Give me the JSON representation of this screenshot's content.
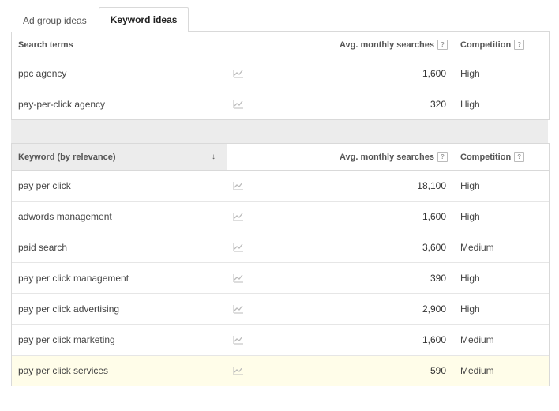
{
  "tabs": {
    "ad_group": "Ad group ideas",
    "keyword": "Keyword ideas"
  },
  "columns": {
    "search_terms": "Search terms",
    "avg_searches": "Avg. monthly searches",
    "competition": "Competition",
    "keyword_relevance": "Keyword (by relevance)"
  },
  "search_terms_rows": [
    {
      "term": "ppc agency",
      "avg": "1,600",
      "competition": "High"
    },
    {
      "term": "pay-per-click agency",
      "avg": "320",
      "competition": "High"
    }
  ],
  "keyword_rows": [
    {
      "term": "pay per click",
      "avg": "18,100",
      "competition": "High"
    },
    {
      "term": "adwords management",
      "avg": "1,600",
      "competition": "High"
    },
    {
      "term": "paid search",
      "avg": "3,600",
      "competition": "Medium"
    },
    {
      "term": "pay per click management",
      "avg": "390",
      "competition": "High"
    },
    {
      "term": "pay per click advertising",
      "avg": "2,900",
      "competition": "High"
    },
    {
      "term": "pay per click marketing",
      "avg": "1,600",
      "competition": "Medium"
    },
    {
      "term": "pay per click services",
      "avg": "590",
      "competition": "Medium"
    }
  ]
}
